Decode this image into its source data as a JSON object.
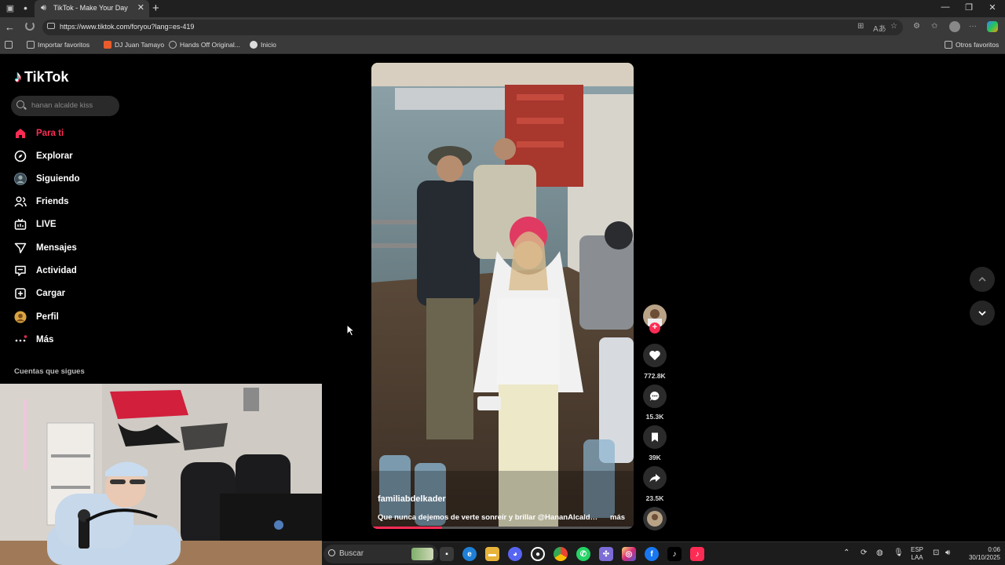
{
  "browser": {
    "tab_title": "TikTok - Make Your Day",
    "url": "https://www.tiktok.com/foryou?lang=es-419",
    "favorites": [
      {
        "label": "Importar favoritos"
      },
      {
        "label": "DJ Juan Tamayo"
      },
      {
        "label": "Hands Off Original..."
      },
      {
        "label": "Inicio"
      }
    ],
    "other_favorites": "Otros favoritos"
  },
  "tiktok": {
    "brand": "TikTok",
    "search_placeholder": "hanan alcalde kiss",
    "nav": [
      {
        "label": "Para ti",
        "icon": "home-icon",
        "active": true
      },
      {
        "label": "Explorar",
        "icon": "compass-icon"
      },
      {
        "label": "Siguiendo",
        "icon": "following-avatar-icon"
      },
      {
        "label": "Friends",
        "icon": "friends-icon"
      },
      {
        "label": "LIVE",
        "icon": "live-icon"
      },
      {
        "label": "Mensajes",
        "icon": "messages-icon"
      },
      {
        "label": "Actividad",
        "icon": "activity-icon"
      },
      {
        "label": "Cargar",
        "icon": "upload-icon"
      },
      {
        "label": "Perfil",
        "icon": "profile-avatar-icon"
      },
      {
        "label": "Más",
        "icon": "more-icon"
      }
    ],
    "following_header": "Cuentas que sigues",
    "video": {
      "author": "familiabdelkader",
      "caption": "Que nunca dejemos de verte sonreír y brillar @HananAlcalde1...",
      "more": "más",
      "progress": 0.27
    },
    "actions": {
      "likes": "772.8K",
      "comments": "15.3K",
      "saves": "39K",
      "shares": "23.5K"
    }
  },
  "taskbar": {
    "search_label": "Buscar",
    "lang_top": "ESP",
    "lang_bottom": "LAA",
    "time": "0:06",
    "date": "30/10/2025"
  },
  "colors": {
    "tiktok_red": "#fe2c55",
    "tiktok_cyan": "#25f4ee",
    "page_bg": "#000000"
  }
}
